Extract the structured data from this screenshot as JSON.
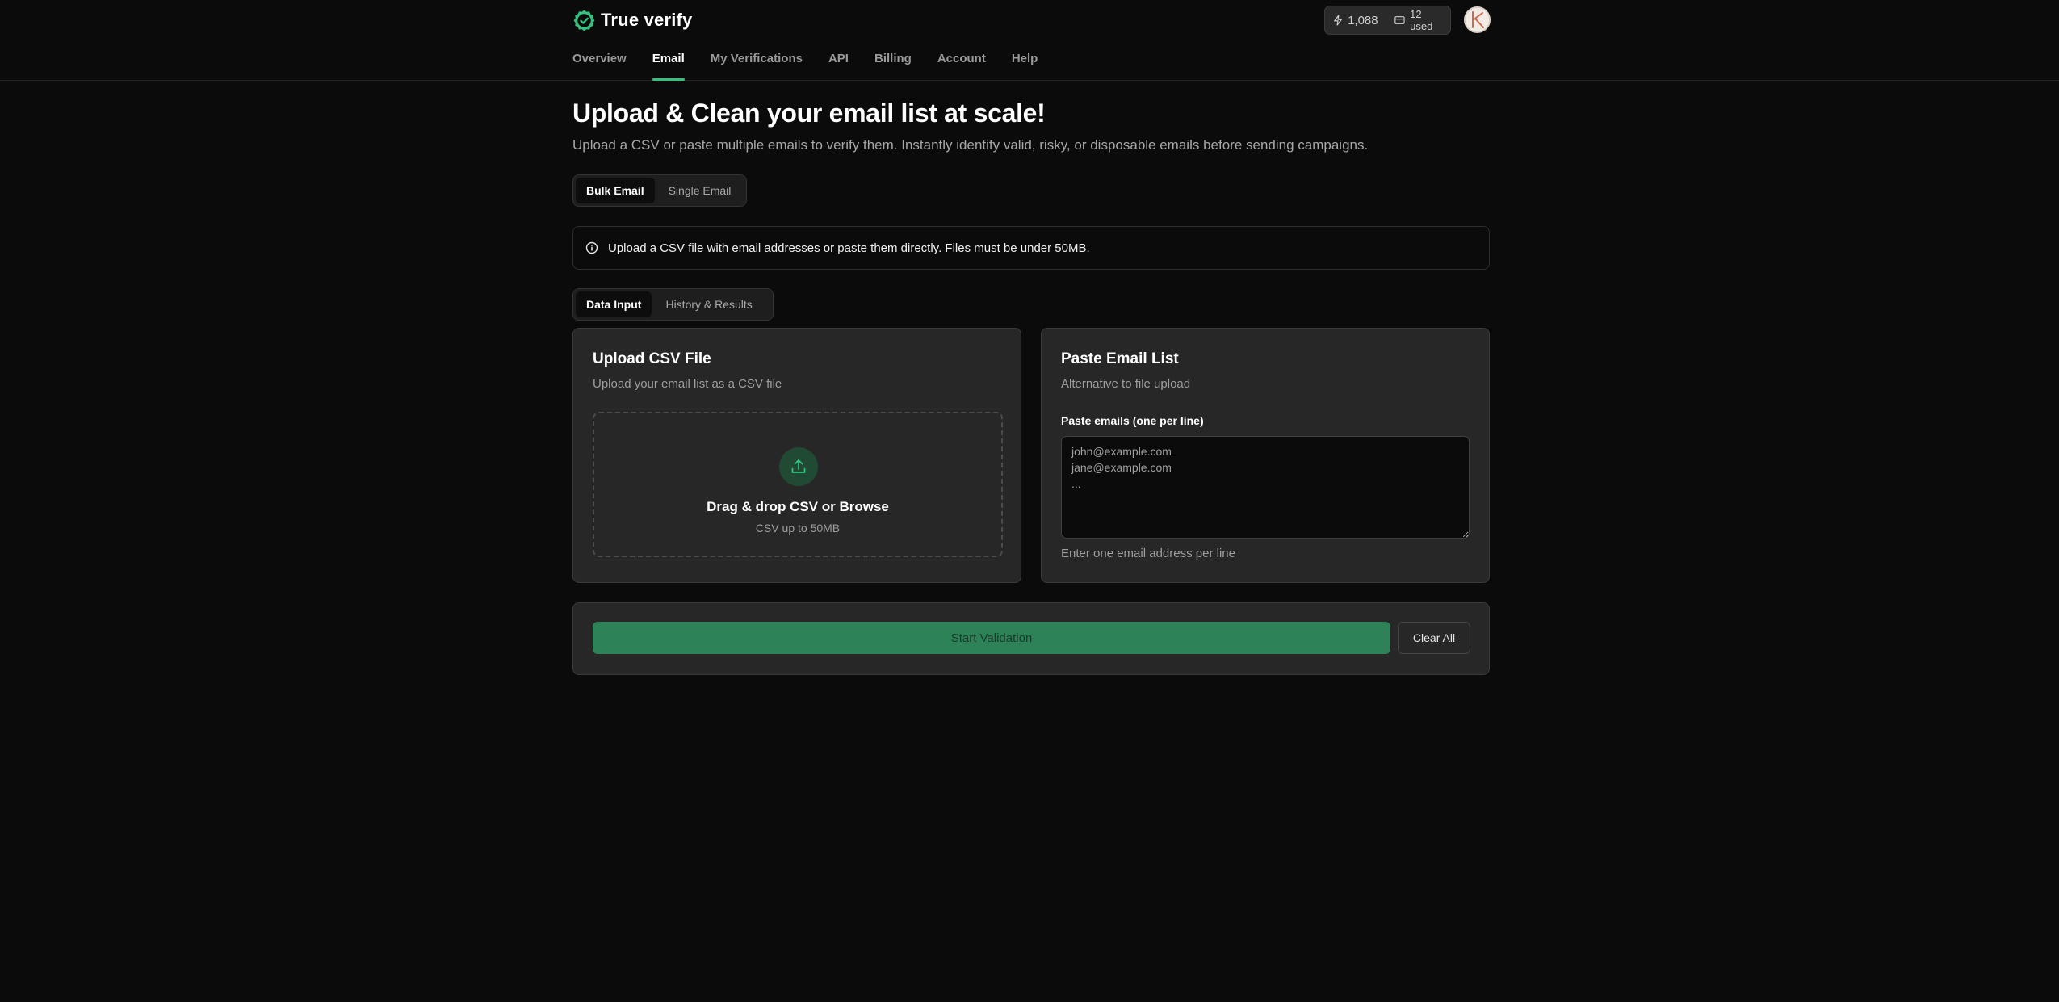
{
  "brand": {
    "name": "True verify",
    "icon": "check-badge-icon",
    "accent": "#35c27f"
  },
  "header": {
    "credits_value": "1,088",
    "credits_icon": "lightning-icon",
    "usage_icon": "card-icon",
    "usage_text": "12 used"
  },
  "nav": {
    "items": [
      "Overview",
      "Email",
      "My Verifications",
      "API",
      "Billing",
      "Account",
      "Help"
    ],
    "active": "Email"
  },
  "page": {
    "title": "Upload & Clean your email list at scale!",
    "subtitle": "Upload a CSV or paste multiple emails to verify them. Instantly identify valid, risky, or disposable emails before sending campaigns."
  },
  "mode_tabs": {
    "bulk": "Bulk Email",
    "single": "Single Email",
    "selected": "Bulk Email"
  },
  "notice": {
    "icon": "info-icon",
    "text": "Upload a CSV file with email addresses or paste them directly. Files must be under 50MB."
  },
  "input_tabs": {
    "data_input": "Data Input",
    "history": "History & Results",
    "selected": "Data Input"
  },
  "upload_card": {
    "title": "Upload CSV File",
    "subtitle": "Upload your email list as a CSV file",
    "drop_icon": "upload-icon",
    "drop_title": "Drag & drop CSV or Browse",
    "drop_sub": "CSV up to 50MB"
  },
  "paste_card": {
    "title": "Paste Email List",
    "subtitle": "Alternative to file upload",
    "label": "Paste emails (one per line)",
    "placeholder": "john@example.com\njane@example.com\n...",
    "value": "",
    "help": "Enter one email address per line"
  },
  "actions": {
    "start": "Start Validation",
    "clear": "Clear All"
  }
}
